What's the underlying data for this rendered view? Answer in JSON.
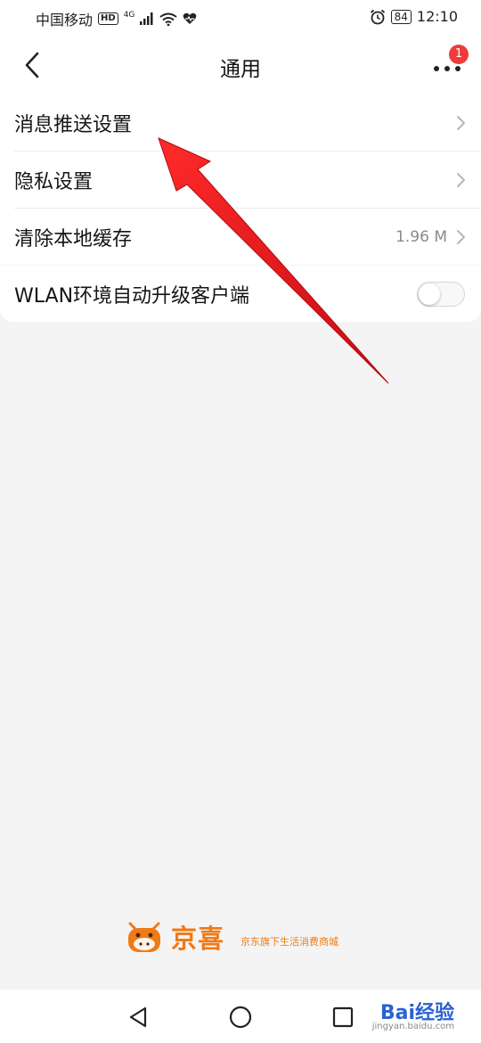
{
  "status_bar": {
    "carrier": "中国移动",
    "hd": "HD",
    "network": "4G",
    "battery": "84",
    "time": "12:10"
  },
  "header": {
    "title": "通用",
    "notification_count": "1"
  },
  "settings": {
    "items": [
      {
        "label": "消息推送设置",
        "value": ""
      },
      {
        "label": "隐私设置",
        "value": ""
      },
      {
        "label": "清除本地缓存",
        "value": "1.96 M"
      }
    ],
    "wlan_toggle": {
      "label": "WLAN环境自动升级客户端",
      "on": false
    }
  },
  "footer": {
    "brand": "京喜",
    "slogan": "京东旗下生活消费商城"
  },
  "watermark": {
    "text": "Bai经验",
    "url": "jingyan.baidu.com"
  },
  "colors": {
    "accent_orange": "#f07a16",
    "badge_red": "#ef3b3b",
    "arrow_red": "#e6141c"
  }
}
